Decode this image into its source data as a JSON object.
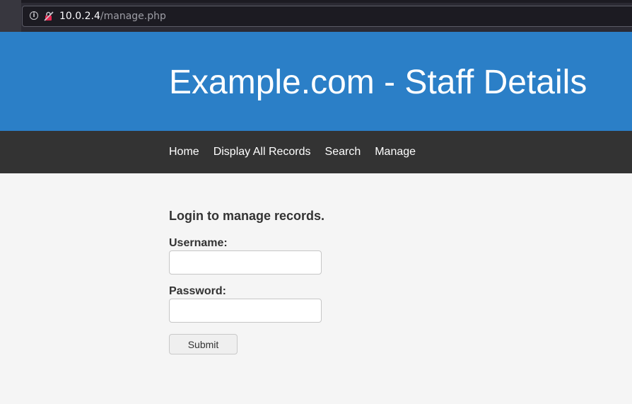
{
  "browser": {
    "url_host": "10.0.2.4",
    "url_path": "/manage.php"
  },
  "header": {
    "title": "Example.com - Staff Details",
    "background_color": "#2b7fc7"
  },
  "nav": {
    "background_color": "#333333",
    "items": [
      {
        "label": "Home"
      },
      {
        "label": "Display All Records"
      },
      {
        "label": "Search"
      },
      {
        "label": "Manage"
      }
    ]
  },
  "login_form": {
    "heading": "Login to manage records.",
    "username_label": "Username:",
    "username_value": "",
    "password_label": "Password:",
    "password_value": "",
    "submit_label": "Submit"
  },
  "icons": {
    "info": "info-icon",
    "insecure": "insecure-connection-icon"
  }
}
